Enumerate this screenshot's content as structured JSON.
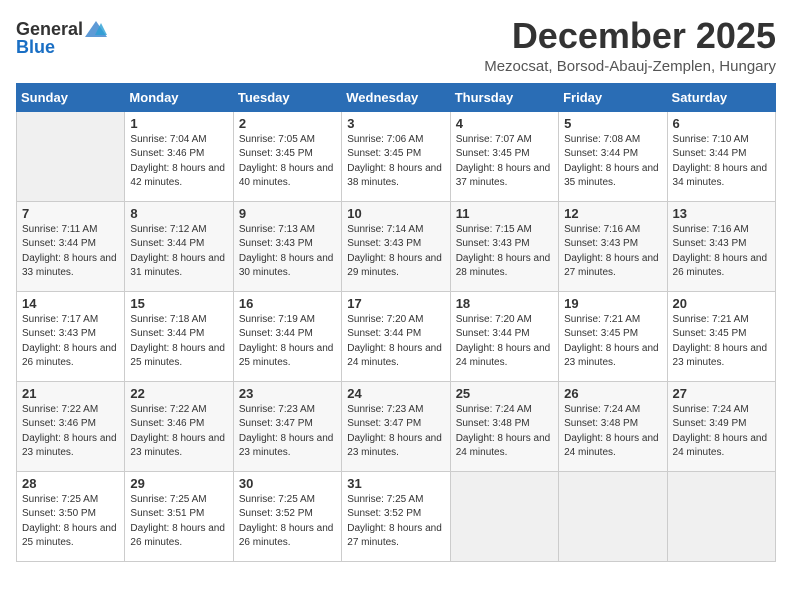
{
  "header": {
    "logo_general": "General",
    "logo_blue": "Blue",
    "month_title": "December 2025",
    "location": "Mezocsat, Borsod-Abauj-Zemplen, Hungary"
  },
  "days_of_week": [
    "Sunday",
    "Monday",
    "Tuesday",
    "Wednesday",
    "Thursday",
    "Friday",
    "Saturday"
  ],
  "weeks": [
    [
      {
        "day": "",
        "sunrise": "",
        "sunset": "",
        "daylight": ""
      },
      {
        "day": "1",
        "sunrise": "Sunrise: 7:04 AM",
        "sunset": "Sunset: 3:46 PM",
        "daylight": "Daylight: 8 hours and 42 minutes."
      },
      {
        "day": "2",
        "sunrise": "Sunrise: 7:05 AM",
        "sunset": "Sunset: 3:45 PM",
        "daylight": "Daylight: 8 hours and 40 minutes."
      },
      {
        "day": "3",
        "sunrise": "Sunrise: 7:06 AM",
        "sunset": "Sunset: 3:45 PM",
        "daylight": "Daylight: 8 hours and 38 minutes."
      },
      {
        "day": "4",
        "sunrise": "Sunrise: 7:07 AM",
        "sunset": "Sunset: 3:45 PM",
        "daylight": "Daylight: 8 hours and 37 minutes."
      },
      {
        "day": "5",
        "sunrise": "Sunrise: 7:08 AM",
        "sunset": "Sunset: 3:44 PM",
        "daylight": "Daylight: 8 hours and 35 minutes."
      },
      {
        "day": "6",
        "sunrise": "Sunrise: 7:10 AM",
        "sunset": "Sunset: 3:44 PM",
        "daylight": "Daylight: 8 hours and 34 minutes."
      }
    ],
    [
      {
        "day": "7",
        "sunrise": "Sunrise: 7:11 AM",
        "sunset": "Sunset: 3:44 PM",
        "daylight": "Daylight: 8 hours and 33 minutes."
      },
      {
        "day": "8",
        "sunrise": "Sunrise: 7:12 AM",
        "sunset": "Sunset: 3:44 PM",
        "daylight": "Daylight: 8 hours and 31 minutes."
      },
      {
        "day": "9",
        "sunrise": "Sunrise: 7:13 AM",
        "sunset": "Sunset: 3:43 PM",
        "daylight": "Daylight: 8 hours and 30 minutes."
      },
      {
        "day": "10",
        "sunrise": "Sunrise: 7:14 AM",
        "sunset": "Sunset: 3:43 PM",
        "daylight": "Daylight: 8 hours and 29 minutes."
      },
      {
        "day": "11",
        "sunrise": "Sunrise: 7:15 AM",
        "sunset": "Sunset: 3:43 PM",
        "daylight": "Daylight: 8 hours and 28 minutes."
      },
      {
        "day": "12",
        "sunrise": "Sunrise: 7:16 AM",
        "sunset": "Sunset: 3:43 PM",
        "daylight": "Daylight: 8 hours and 27 minutes."
      },
      {
        "day": "13",
        "sunrise": "Sunrise: 7:16 AM",
        "sunset": "Sunset: 3:43 PM",
        "daylight": "Daylight: 8 hours and 26 minutes."
      }
    ],
    [
      {
        "day": "14",
        "sunrise": "Sunrise: 7:17 AM",
        "sunset": "Sunset: 3:43 PM",
        "daylight": "Daylight: 8 hours and 26 minutes."
      },
      {
        "day": "15",
        "sunrise": "Sunrise: 7:18 AM",
        "sunset": "Sunset: 3:44 PM",
        "daylight": "Daylight: 8 hours and 25 minutes."
      },
      {
        "day": "16",
        "sunrise": "Sunrise: 7:19 AM",
        "sunset": "Sunset: 3:44 PM",
        "daylight": "Daylight: 8 hours and 25 minutes."
      },
      {
        "day": "17",
        "sunrise": "Sunrise: 7:20 AM",
        "sunset": "Sunset: 3:44 PM",
        "daylight": "Daylight: 8 hours and 24 minutes."
      },
      {
        "day": "18",
        "sunrise": "Sunrise: 7:20 AM",
        "sunset": "Sunset: 3:44 PM",
        "daylight": "Daylight: 8 hours and 24 minutes."
      },
      {
        "day": "19",
        "sunrise": "Sunrise: 7:21 AM",
        "sunset": "Sunset: 3:45 PM",
        "daylight": "Daylight: 8 hours and 23 minutes."
      },
      {
        "day": "20",
        "sunrise": "Sunrise: 7:21 AM",
        "sunset": "Sunset: 3:45 PM",
        "daylight": "Daylight: 8 hours and 23 minutes."
      }
    ],
    [
      {
        "day": "21",
        "sunrise": "Sunrise: 7:22 AM",
        "sunset": "Sunset: 3:46 PM",
        "daylight": "Daylight: 8 hours and 23 minutes."
      },
      {
        "day": "22",
        "sunrise": "Sunrise: 7:22 AM",
        "sunset": "Sunset: 3:46 PM",
        "daylight": "Daylight: 8 hours and 23 minutes."
      },
      {
        "day": "23",
        "sunrise": "Sunrise: 7:23 AM",
        "sunset": "Sunset: 3:47 PM",
        "daylight": "Daylight: 8 hours and 23 minutes."
      },
      {
        "day": "24",
        "sunrise": "Sunrise: 7:23 AM",
        "sunset": "Sunset: 3:47 PM",
        "daylight": "Daylight: 8 hours and 23 minutes."
      },
      {
        "day": "25",
        "sunrise": "Sunrise: 7:24 AM",
        "sunset": "Sunset: 3:48 PM",
        "daylight": "Daylight: 8 hours and 24 minutes."
      },
      {
        "day": "26",
        "sunrise": "Sunrise: 7:24 AM",
        "sunset": "Sunset: 3:48 PM",
        "daylight": "Daylight: 8 hours and 24 minutes."
      },
      {
        "day": "27",
        "sunrise": "Sunrise: 7:24 AM",
        "sunset": "Sunset: 3:49 PM",
        "daylight": "Daylight: 8 hours and 24 minutes."
      }
    ],
    [
      {
        "day": "28",
        "sunrise": "Sunrise: 7:25 AM",
        "sunset": "Sunset: 3:50 PM",
        "daylight": "Daylight: 8 hours and 25 minutes."
      },
      {
        "day": "29",
        "sunrise": "Sunrise: 7:25 AM",
        "sunset": "Sunset: 3:51 PM",
        "daylight": "Daylight: 8 hours and 26 minutes."
      },
      {
        "day": "30",
        "sunrise": "Sunrise: 7:25 AM",
        "sunset": "Sunset: 3:52 PM",
        "daylight": "Daylight: 8 hours and 26 minutes."
      },
      {
        "day": "31",
        "sunrise": "Sunrise: 7:25 AM",
        "sunset": "Sunset: 3:52 PM",
        "daylight": "Daylight: 8 hours and 27 minutes."
      },
      {
        "day": "",
        "sunrise": "",
        "sunset": "",
        "daylight": ""
      },
      {
        "day": "",
        "sunrise": "",
        "sunset": "",
        "daylight": ""
      },
      {
        "day": "",
        "sunrise": "",
        "sunset": "",
        "daylight": ""
      }
    ]
  ]
}
